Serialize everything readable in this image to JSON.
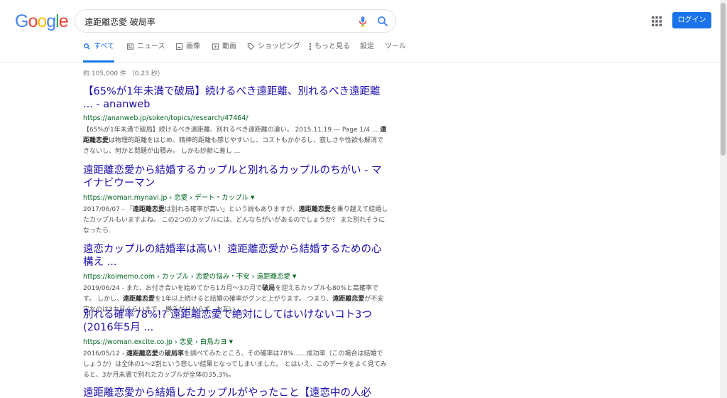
{
  "logo": [
    "G",
    "o",
    "o",
    "g",
    "l",
    "e"
  ],
  "search": {
    "query": "遠距離恋愛 破局率"
  },
  "header": {
    "login_label": "ログイン"
  },
  "tabs": [
    {
      "label": "すべて",
      "icon": "search-icon"
    },
    {
      "label": "ニュース",
      "icon": "news-icon"
    },
    {
      "label": "画像",
      "icon": "image-icon"
    },
    {
      "label": "動画",
      "icon": "video-icon"
    },
    {
      "label": "ショッピング",
      "icon": "tag-icon"
    },
    {
      "label": "もっと見る",
      "icon": "more-vert-icon"
    },
    {
      "label": "設定"
    },
    {
      "label": "ツール"
    }
  ],
  "stats": "約 105,000 件 （0.23 秒）",
  "results": [
    {
      "title": "【65%が1年未満で破局】続けるべき遠距離、別れるべき遠距離 ... - ananweb",
      "url": "https://ananweb.jp/soken/topics/research/47464/",
      "snippet_html": "【65%が1年未満で破局】続けるべき遠距離、別れるべき遠距離の違い。 2015.11.19 — Page 1/4 ... <b>遠距離恋愛</b>は物理的距離をはじめ、精神的距離も感じやすいし、コストもかかるし、寂しさや性欲も解消できないし、何かと問題が山積み。 しかも妙齢に差し ..."
    },
    {
      "title": "遠距離恋愛から結婚するカップルと別れるカップルのちがい - マイナビウーマン",
      "url": "https://woman.mynavi.jp › 恋愛 › デート・カップル",
      "snippet_html": "2017/06/07 - 「<b>遠距離恋愛</b>は別れる確率が高い」という説もありますが、<b>遠距離恋愛</b>を乗り越えて結婚したカップルもいますよね。 この2つのカップルには、どんなちがいがあるのでしょうか？ また別れそうになったら."
    },
    {
      "title": "遠恋カップルの結婚率は高い！遠距離恋愛から結婚するための心構え ...",
      "url": "https://koimemo.com › カップル › 恋愛の悩み・不安 › 遠距離恋愛",
      "snippet_html": "2019/06/24 - また、お付き合いを始めてから1カ月〜3カ月で<b>破局</b>を迎えるカップルも80%と高確率です。 しかし、<b>遠距離恋愛</b>を1年以上続けると結婚の確率がグンと上がります。 つまり、<b>遠距離恋愛</b>が不安定なのは3カ月くらいまで。 勝手が分からず、お互い ..."
    },
    {
      "title": "別れる確率78%!? 遠距離恋愛で絶対にしてはいけないコト3つ(2016年5月 ...",
      "url": "https://woman.excite.co.jp › 恋愛 › 白鳥カヨ",
      "snippet_html": "2016/05/12 - <b>遠距離恋愛</b>の<b>破局率</b>を調べてみたところ、その確率は78%……成功率（この場合は結婚でしょうか）は全体の1〜2割という悲しい結果となってしまいました。 とはいえ、このデータをよく見てみると、3か月未満で別れたカップルが全体の35.3%。"
    },
    {
      "title": "遠距離恋愛から結婚したカップルがやったこと【遠恋中の人必見】 -"
    }
  ],
  "colors": {
    "link": "#1a0dab",
    "url": "#006621",
    "accent": "#1a73e8"
  }
}
